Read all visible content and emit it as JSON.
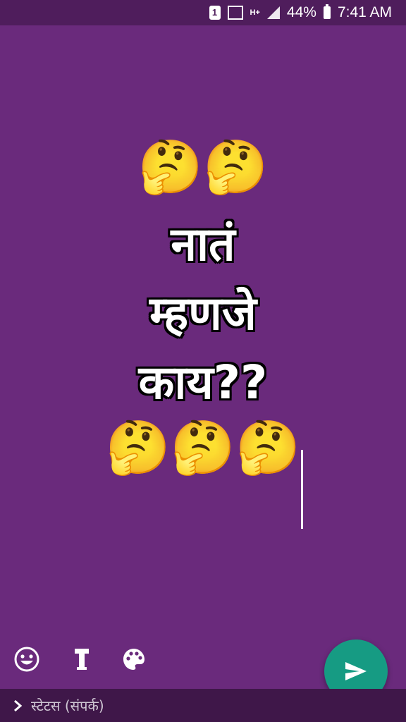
{
  "status_bar": {
    "sim_badge": "1",
    "network_type": "H+",
    "battery_percent": "44%",
    "time": "7:41 AM"
  },
  "status_content": {
    "emoji_top": "🤔🤔",
    "line1": "नातं",
    "line2": "म्हणजे",
    "line3": "काय??",
    "emoji_bottom": "🤔🤔🤔"
  },
  "bottom_bar": {
    "audience_label": "स्टेटस (संपर्क)"
  },
  "colors": {
    "background": "#6a2a7c",
    "status_bar": "#4f1d5c",
    "bottom_bar": "#3f1749",
    "send_button": "#169b83"
  },
  "icons": {
    "emoji_tool": "smiley-icon",
    "text_tool": "text-format-icon",
    "color_tool": "palette-icon",
    "send": "send-icon",
    "audience": "chevron-right-icon"
  }
}
